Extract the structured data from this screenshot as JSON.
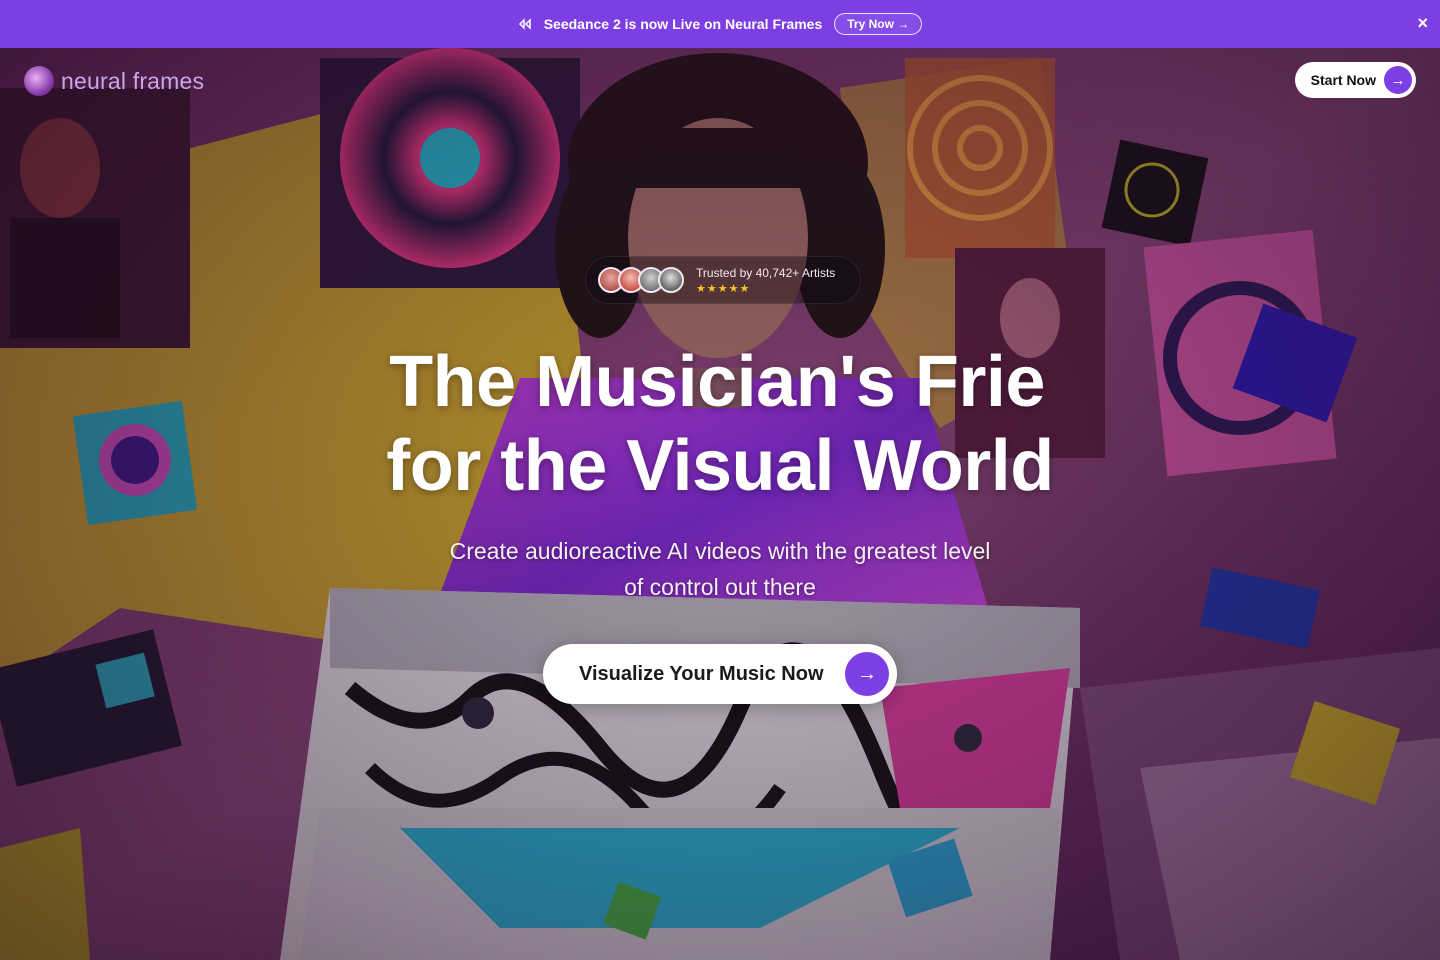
{
  "announcement": {
    "text": "Seedance 2 is now Live on Neural Frames",
    "cta_label": "Try Now →",
    "close_label": "×",
    "icon": "sparkle-icon"
  },
  "header": {
    "logo_text": "neural frames",
    "start_label": "Start Now",
    "start_icon": "arrow-right-icon"
  },
  "trust": {
    "label": "Trusted by 40,742+ Artists",
    "stars": "★★★★★",
    "avatar_count": 4
  },
  "hero": {
    "headline_line1": "The Musician's Frie",
    "headline_line2": "for the Visual World",
    "subtitle_line1": "Create audioreactive AI videos with the greatest level",
    "subtitle_line2": "of control out there",
    "cta_label": "Visualize Your Music Now",
    "cta_icon": "arrow-right-icon"
  },
  "colors": {
    "brand_purple": "#7b3fe4",
    "star_yellow": "#f7c325"
  }
}
